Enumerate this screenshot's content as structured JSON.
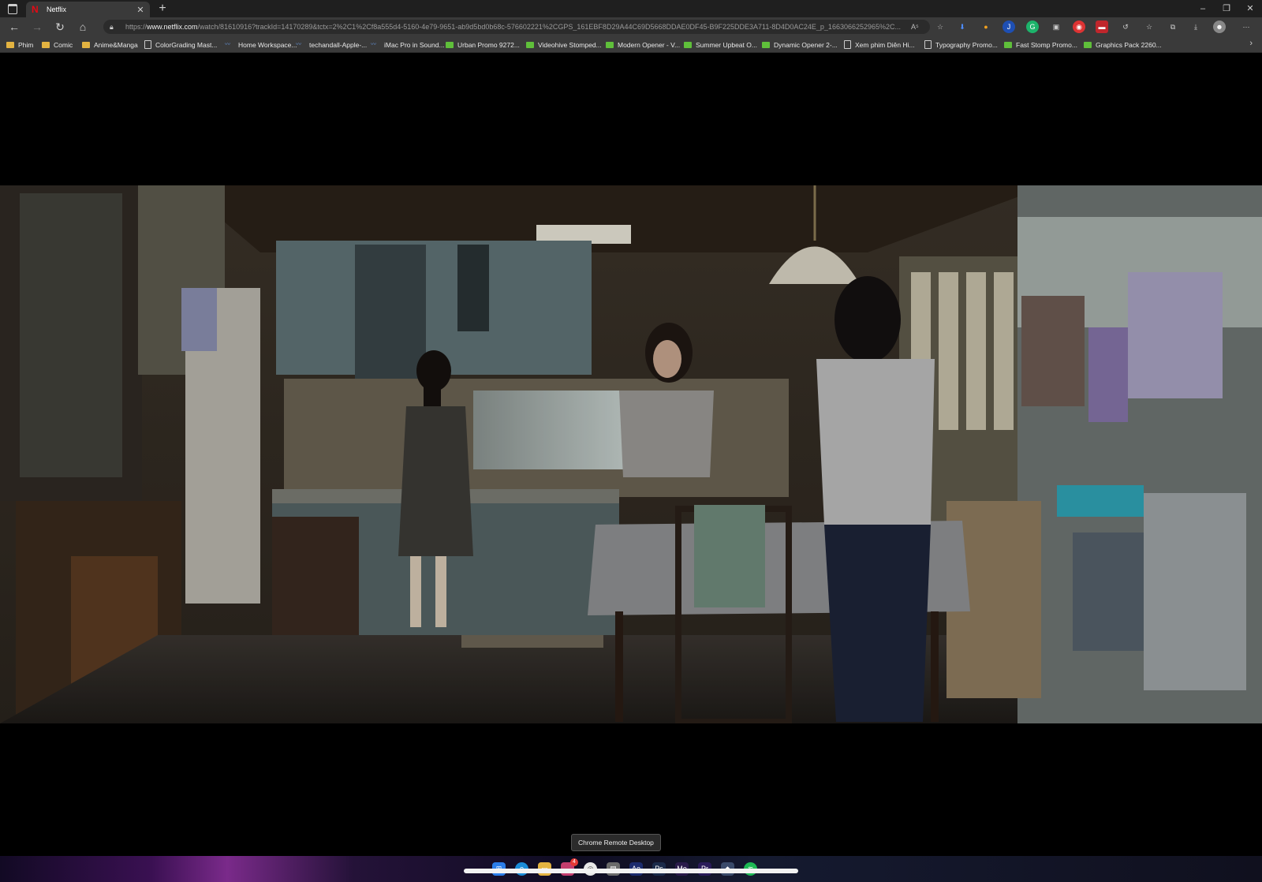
{
  "browser": {
    "tab": {
      "title": "Netflix",
      "favicon": "netflix-icon"
    },
    "new_tab_symbol": "+",
    "window_controls": [
      "–",
      "❐",
      "✕"
    ],
    "url_prefix": "https://",
    "url_domain": "www.netflix.com",
    "url_rest": "/watch/81610916?trackId=14170289&tctx=2%2C1%2Cf8a555d4-5160-4e79-9651-ab9d5bd0b68c-576602221%2CGPS_161EBF8D29A44C69D5668DDAE0DF45-B9F225DDE3A711-8D4D0AC24E_p_1663066252965%2C...",
    "read_aloud": "A⁵"
  },
  "bookmarks": [
    {
      "label": "Phim",
      "icon": "folder"
    },
    {
      "label": "Comic",
      "icon": "folder"
    },
    {
      "label": "Anime&Manga",
      "icon": "folder"
    },
    {
      "label": "ColorGrading Mast...",
      "icon": "page"
    },
    {
      "label": "Home Workspace...",
      "icon": "blue"
    },
    {
      "label": "techandall-Apple-...",
      "icon": "blue"
    },
    {
      "label": "iMac Pro in Sound...",
      "icon": "blue"
    },
    {
      "label": "Urban Promo 9272...",
      "icon": "green"
    },
    {
      "label": "Videohive Stomped...",
      "icon": "green"
    },
    {
      "label": "Modern Opener - V...",
      "icon": "green"
    },
    {
      "label": "Summer Upbeat O...",
      "icon": "green"
    },
    {
      "label": "Dynamic Opener 2-...",
      "icon": "green"
    },
    {
      "label": "Xem phim Diên Hi...",
      "icon": "page"
    },
    {
      "label": "Typography Promo...",
      "icon": "page"
    },
    {
      "label": "Fast Stomp Promo...",
      "icon": "green"
    },
    {
      "label": "Graphics Pack 2260...",
      "icon": "green"
    }
  ],
  "tooltip": "Chrome Remote Desktop",
  "taskbar_badge": "4",
  "colors": {
    "netflix_red": "#e50914",
    "tab_active": "#3a3a3a",
    "toolbar": "#3a3a3a",
    "taskbar_accent": "#7a2a8a"
  }
}
